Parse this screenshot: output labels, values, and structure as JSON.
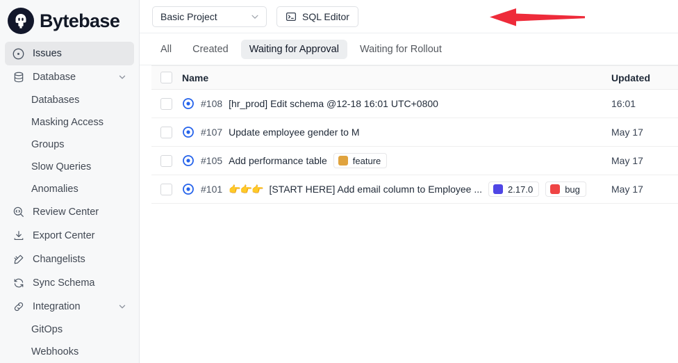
{
  "brand": {
    "name": "Bytebase",
    "logo_icon": "bytebase-logo-icon"
  },
  "sidebar": {
    "items": [
      {
        "label": "Issues",
        "icon": "target-circle-icon",
        "selected": true,
        "expandable": false,
        "sub": false
      },
      {
        "label": "Database",
        "icon": "database-icon",
        "selected": false,
        "expandable": true,
        "sub": false
      },
      {
        "label": "Databases",
        "icon": "",
        "selected": false,
        "expandable": false,
        "sub": true
      },
      {
        "label": "Masking Access",
        "icon": "",
        "selected": false,
        "expandable": false,
        "sub": true
      },
      {
        "label": "Groups",
        "icon": "",
        "selected": false,
        "expandable": false,
        "sub": true
      },
      {
        "label": "Slow Queries",
        "icon": "",
        "selected": false,
        "expandable": false,
        "sub": true
      },
      {
        "label": "Anomalies",
        "icon": "",
        "selected": false,
        "expandable": false,
        "sub": true
      },
      {
        "label": "Review Center",
        "icon": "review-magnifier-icon",
        "selected": false,
        "expandable": false,
        "sub": false
      },
      {
        "label": "Export Center",
        "icon": "download-icon",
        "selected": false,
        "expandable": false,
        "sub": false
      },
      {
        "label": "Changelists",
        "icon": "changelist-icon",
        "selected": false,
        "expandable": false,
        "sub": false
      },
      {
        "label": "Sync Schema",
        "icon": "sync-icon",
        "selected": false,
        "expandable": false,
        "sub": false
      },
      {
        "label": "Integration",
        "icon": "link-icon",
        "selected": false,
        "expandable": true,
        "sub": false
      },
      {
        "label": "GitOps",
        "icon": "",
        "selected": false,
        "expandable": false,
        "sub": true
      },
      {
        "label": "Webhooks",
        "icon": "",
        "selected": false,
        "expandable": false,
        "sub": true
      }
    ]
  },
  "toolbar": {
    "project_selected": "Basic Project",
    "project_chevron_icon": "chevron-down-icon",
    "sql_editor_label": "SQL Editor",
    "sql_editor_icon": "terminal-icon",
    "annotation_arrow_icon": "red-arrow-left-icon",
    "annotation_arrow_color": "#ee2b3a"
  },
  "tabs": [
    {
      "label": "All",
      "active": false
    },
    {
      "label": "Created",
      "active": false
    },
    {
      "label": "Waiting for Approval",
      "active": true
    },
    {
      "label": "Waiting for Rollout",
      "active": false
    }
  ],
  "table": {
    "columns": {
      "name": "Name",
      "updated": "Updated"
    },
    "select_all_checkbox": "unchecked",
    "rows": [
      {
        "id": "#108",
        "title": "[hr_prod] Edit schema @12-18 16:01 UTC+0800",
        "emoji": "",
        "status_icon": "open-circle-dot-icon",
        "labels": [],
        "updated": "16:01"
      },
      {
        "id": "#107",
        "title": "Update employee gender to M",
        "emoji": "",
        "status_icon": "open-circle-dot-icon",
        "labels": [],
        "updated": "May 17"
      },
      {
        "id": "#105",
        "title": "Add performance table",
        "emoji": "",
        "status_icon": "open-circle-dot-icon",
        "labels": [
          {
            "text": "feature",
            "color": "#e0a33e"
          }
        ],
        "updated": "May 17"
      },
      {
        "id": "#101",
        "title": "[START HERE] Add email column to Employee ...",
        "emoji": "👉👉👉",
        "status_icon": "open-circle-dot-icon",
        "labels": [
          {
            "text": "2.17.0",
            "color": "#4f46e5"
          },
          {
            "text": "bug",
            "color": "#ef4444"
          }
        ],
        "updated": "May 17"
      }
    ]
  },
  "colors": {
    "accent_blue": "#2563eb",
    "sidebar_bg": "#f7f8f9",
    "selected_bg": "#e7e8ea",
    "border": "#e5e7eb"
  }
}
